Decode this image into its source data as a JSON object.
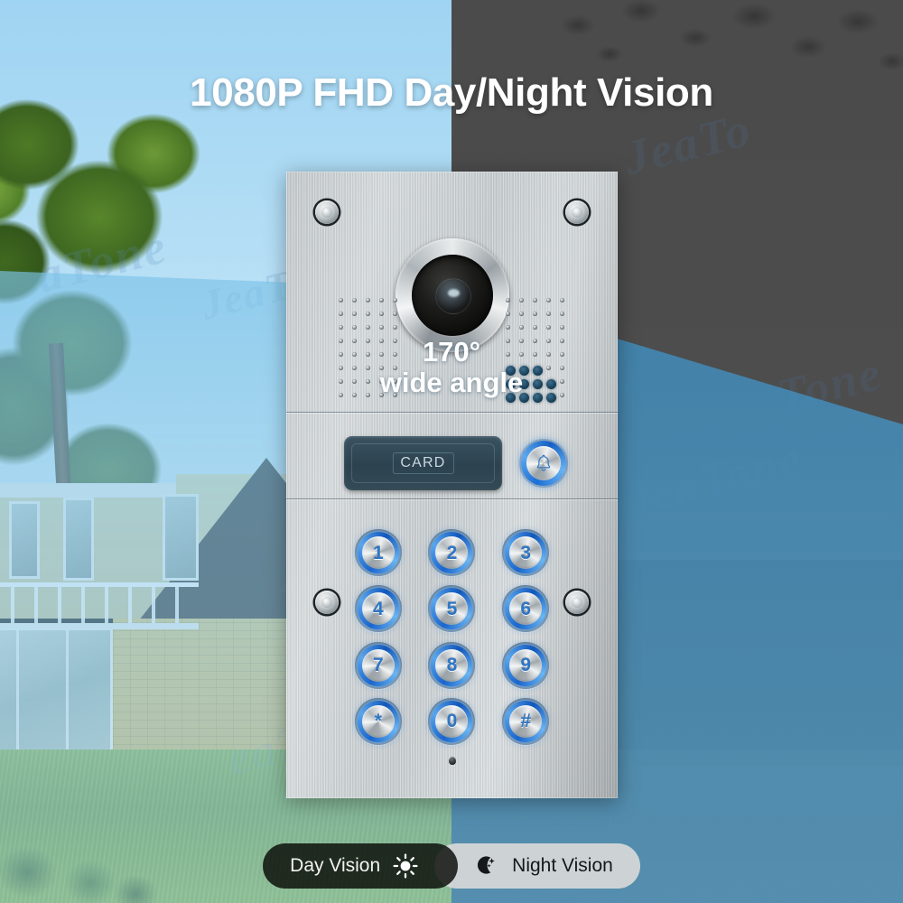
{
  "header": {
    "title": "1080P FHD Day/Night Vision"
  },
  "overlay": {
    "angle_value": "170°",
    "angle_label": "wide angle"
  },
  "device": {
    "name": "video-door-phone-panel",
    "camera": {
      "label": "camera-lens"
    },
    "card_reader": {
      "label": "CARD"
    },
    "bell_button": {
      "label": "doorbell-bell-icon"
    },
    "keypad": {
      "rows": [
        [
          "1",
          "2",
          "3"
        ],
        [
          "4",
          "5",
          "6"
        ],
        [
          "7",
          "8",
          "9"
        ],
        [
          "*",
          "0",
          "#"
        ]
      ]
    },
    "microphone": {
      "label": "microphone-hole"
    }
  },
  "badges": [
    {
      "id": "day",
      "label": "Day Vision",
      "icon": "sun-icon"
    },
    {
      "id": "night",
      "label": "Night Vision",
      "icon": "moon-stars-icon"
    }
  ],
  "watermarks": [
    "aTone",
    "JeaT",
    "JeaTo",
    "Tone",
    "JeaTone",
    "eaTone"
  ],
  "colors": {
    "sky": "#9fd4f2",
    "night_overlay": "#404040",
    "cone_blue": "#4a95c4",
    "accent_button_blue": "#1a66cd",
    "title_text": "#ffffff",
    "panel_metal": "#c4cacd",
    "lawn_green": "#5f9230",
    "badge_day_bg": "#080a06",
    "badge_night_bg": "#d6d8d8"
  }
}
